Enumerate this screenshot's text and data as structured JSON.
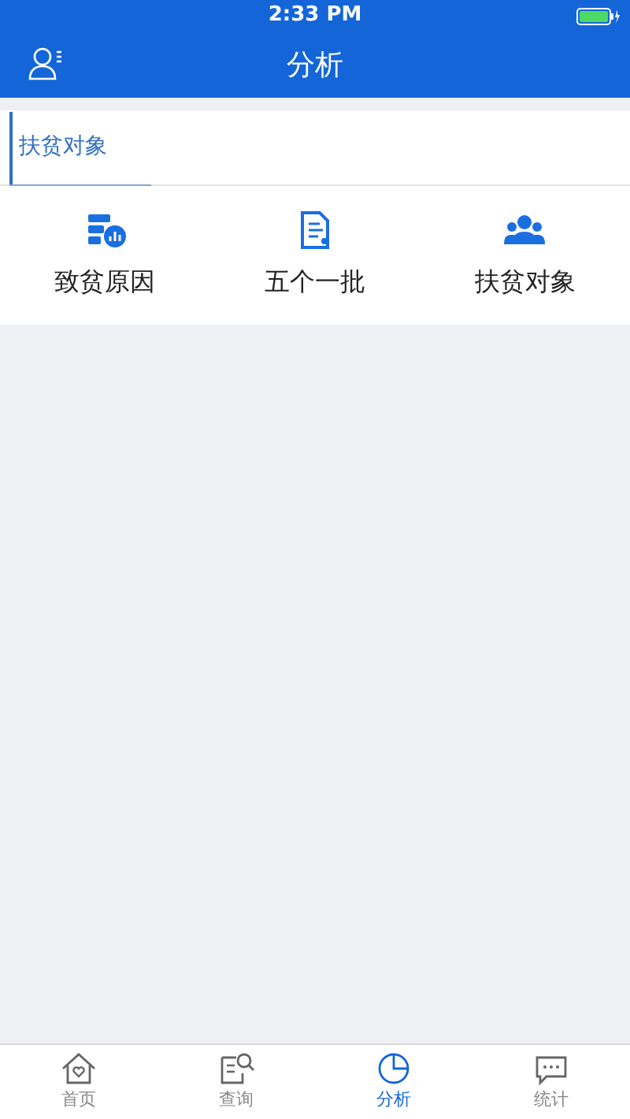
{
  "status_bar": {
    "time": "2:33 PM"
  },
  "nav": {
    "title": "分析"
  },
  "section_tabs": [
    {
      "label": "扶贫对象",
      "selected": true
    }
  ],
  "grid": [
    {
      "label": "致贫原因"
    },
    {
      "label": "五个一批"
    },
    {
      "label": "扶贫对象"
    }
  ],
  "tab_bar": [
    {
      "label": "首页",
      "selected": false
    },
    {
      "label": "查询",
      "selected": false
    },
    {
      "label": "分析",
      "selected": true
    },
    {
      "label": "统计",
      "selected": false
    }
  ]
}
